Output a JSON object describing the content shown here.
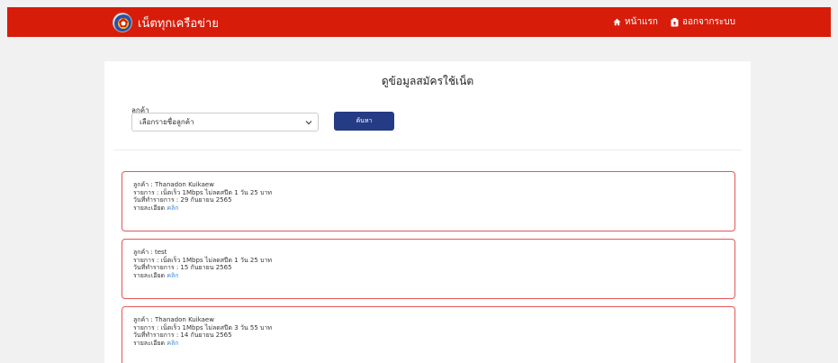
{
  "header": {
    "brand": "เน็ตทุกเครือข่าย",
    "nav": [
      {
        "label": "หน้าแรก",
        "icon": "home-icon"
      },
      {
        "label": "ออกจากระบบ",
        "icon": "logout-icon"
      }
    ]
  },
  "main": {
    "title": "ดูข้อมูลสมัครใช้เน็ต",
    "filter": {
      "label": "ลูกค้า",
      "select_value": "เลือกรายชื่อลูกค้า",
      "button_label": "ค้นหา"
    },
    "orders": [
      {
        "customer": "ลูกค้า : Thanadon Kuikaew",
        "item": "รายการ : เน็ตเร็ว 1Mbps ไม่ลดสปีด 1 วัน 25 บาท",
        "date": "วันที่ทำรายการ : 29 กันยายน 2565",
        "detail_label": "รายละเอียด",
        "detail_link": "คลิก"
      },
      {
        "customer": "ลูกค้า : test",
        "item": "รายการ : เน็ตเร็ว 1Mbps ไม่ลดสปีด 1 วัน 25 บาท",
        "date": "วันที่ทำรายการ : 15 กันยายน 2565",
        "detail_label": "รายละเอียด",
        "detail_link": "คลิก"
      },
      {
        "customer": "ลูกค้า : Thanadon Kuikaew",
        "item": "รายการ : เน็ตเร็ว 1Mbps ไม่ลดสปีด 3 วัน 55 บาท",
        "date": "วันที่ทำรายการ : 14 กันยายน 2565",
        "detail_label": "รายละเอียด",
        "detail_link": "คลิก"
      }
    ]
  },
  "colors": {
    "header_bg": "#d81c0a",
    "button_bg": "#243b85",
    "card_border": "#e55656",
    "link": "#3a8ad6",
    "page_bg": "#f1f1f1"
  }
}
